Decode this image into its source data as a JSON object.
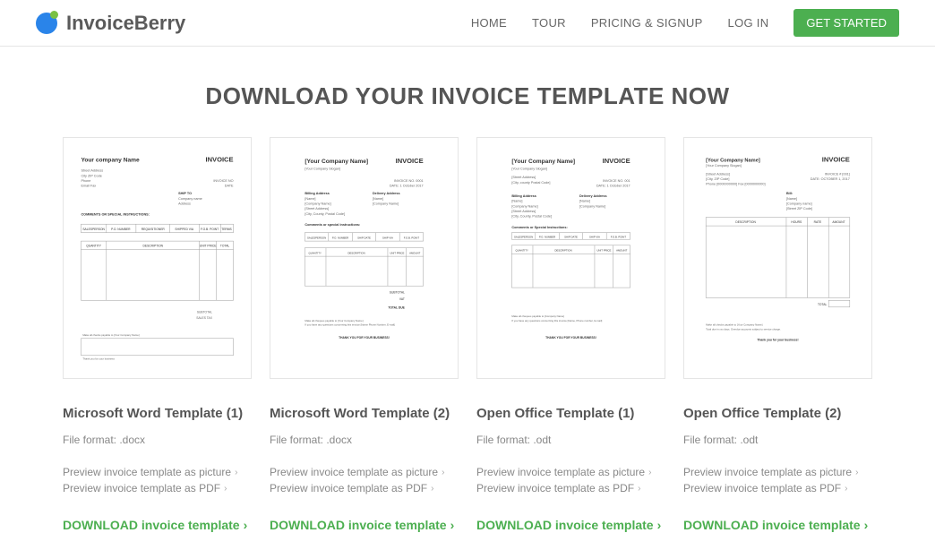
{
  "brand": "InvoiceBerry",
  "nav": {
    "home": "HOME",
    "tour": "TOUR",
    "pricing": "PRICING & SIGNUP",
    "login": "LOG IN",
    "cta": "GET STARTED"
  },
  "page_title": "DOWNLOAD YOUR INVOICE TEMPLATE NOW",
  "preview_pic": "Preview invoice template as picture",
  "preview_pdf": "Preview invoice template as PDF",
  "download_label": "DOWNLOAD invoice template",
  "cards": [
    {
      "title": "Microsoft Word Template (1)",
      "format": "File format: .docx"
    },
    {
      "title": "Microsoft Word Template (2)",
      "format": "File format: .docx"
    },
    {
      "title": "Open Office Template (1)",
      "format": "File format: .odt"
    },
    {
      "title": "Open Office Template (2)",
      "format": "File format: .odt"
    }
  ]
}
